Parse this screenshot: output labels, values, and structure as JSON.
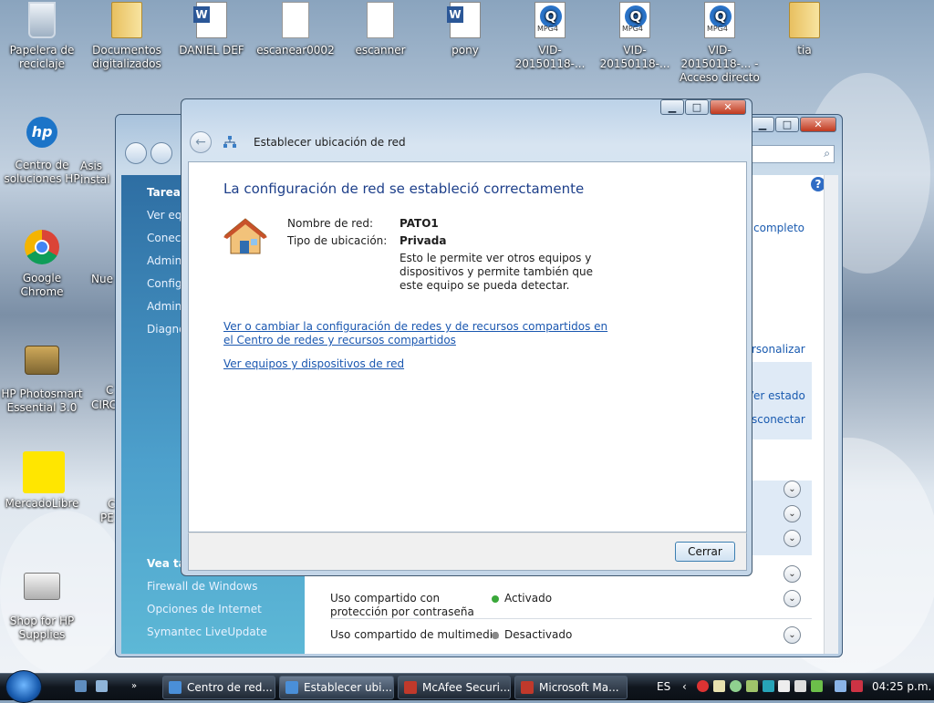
{
  "desktop": {
    "icons": [
      {
        "label": "Papelera de reciclaje"
      },
      {
        "label": "Documentos digitalizados"
      },
      {
        "label": "DANIEL DEF"
      },
      {
        "label": "escanear0002"
      },
      {
        "label": "escanner"
      },
      {
        "label": "pony"
      },
      {
        "label": "VID-20150118-..."
      },
      {
        "label": "VID-20150118-..."
      },
      {
        "label": "VID-20150118-... - Acceso directo"
      },
      {
        "label": "tia"
      },
      {
        "label": "Centro de soluciones HP"
      },
      {
        "label": "Google Chrome"
      },
      {
        "label": "HP Photosmart Essential 3.0"
      },
      {
        "label": "MercadoLibre"
      },
      {
        "label": "Shop for HP Supplies"
      }
    ],
    "partial": [
      "Asis",
      "instal",
      "Nue",
      "C",
      "CIRC",
      "C",
      "PE",
      "C"
    ]
  },
  "back_window": {
    "left_pane": {
      "tasks_header": "Tareas",
      "tasks": [
        "Ver equ",
        "Conect",
        "Admin",
        "Config",
        "Admin",
        "Diagno"
      ],
      "see_also_header": "Vea ta",
      "see_also": [
        "Firewall de Windows",
        "Opciones de Internet",
        "Symantec LiveUpdate"
      ]
    },
    "right": {
      "completo": "completo",
      "personalizar": "rsonalizar",
      "ver_estado": "/er estado",
      "desconectar": "sconectar"
    },
    "sharing": [
      {
        "label": "Uso compartido con protección por contraseña",
        "status": "Activado",
        "color": "#3aa83a"
      },
      {
        "label": "Uso compartido de multimedia",
        "status": "Desactivado",
        "color": "#8a8a8a"
      }
    ]
  },
  "dialog": {
    "title": "Establecer ubicación de red",
    "heading": "La configuración de red se estableció correctamente",
    "network_name_label": "Nombre de red:",
    "network_name": "PATO1",
    "location_type_label": "Tipo de ubicación:",
    "location_type": "Privada",
    "description": "Esto le permite ver otros equipos y dispositivos y permite también que este equipo se pueda detectar.",
    "link1_line1": "Ver o cambiar la configuración de redes y de recursos compartidos en",
    "link1_line2": "el Centro de redes y recursos compartidos",
    "link2": "Ver equipos y dispositivos de red",
    "close_button": "Cerrar"
  },
  "taskbar": {
    "buttons": [
      {
        "label": "Centro de red...",
        "color": "#4a8fd8"
      },
      {
        "label": "Establecer ubi...",
        "color": "#4a8fd8"
      },
      {
        "label": "McAfee Securi...",
        "color": "#c0392b"
      },
      {
        "label": "Microsoft Ma...",
        "color": "#c0392b"
      }
    ],
    "language": "ES",
    "clock": "04:25 p.m.",
    "accent": "#1a5db0"
  }
}
